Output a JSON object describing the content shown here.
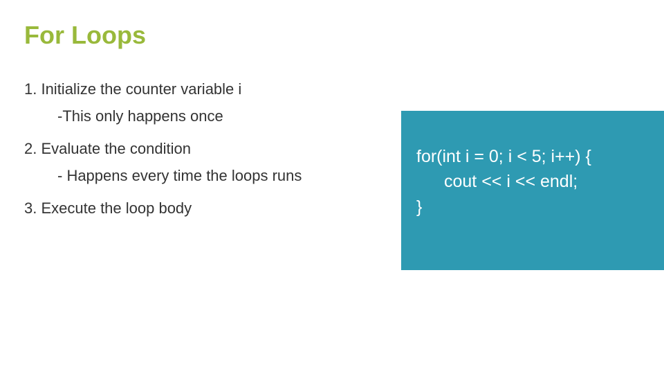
{
  "title": "For Loops",
  "steps": {
    "s1": "1. Initialize the counter variable i",
    "s1sub": "-This only happens once",
    "s2": "2. Evaluate the condition",
    "s2sub": "- Happens every time the loops runs",
    "s3": "3. Execute the loop body"
  },
  "code": {
    "line1": "for(int i = 0; i < 5; i++) {",
    "line2": "cout << i << endl;",
    "line3": "}"
  }
}
